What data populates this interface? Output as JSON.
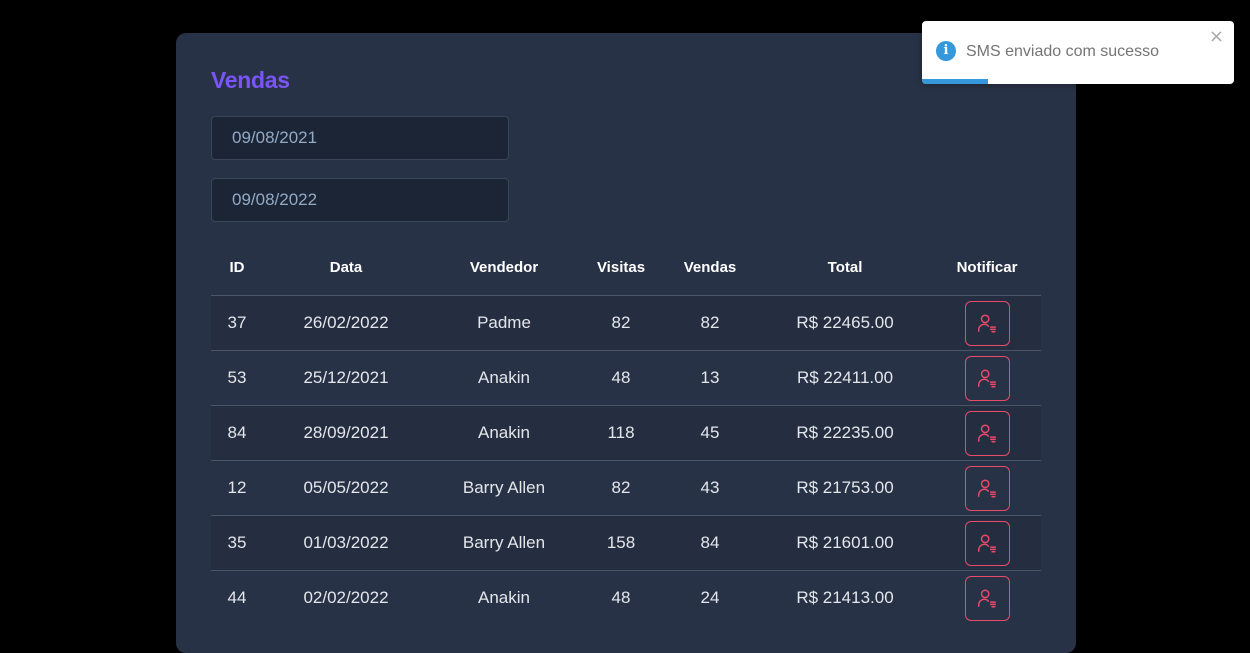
{
  "page": {
    "title": "Vendas",
    "title_color": "#7b54f6"
  },
  "filters": {
    "min_date": "09/08/2021",
    "max_date": "09/08/2022"
  },
  "table": {
    "headers": {
      "id": "ID",
      "date": "Data",
      "seller": "Vendedor",
      "visits": "Visitas",
      "sales": "Vendas",
      "total": "Total",
      "notify": "Notificar"
    },
    "rows": [
      {
        "id": "37",
        "date": "26/02/2022",
        "seller": "Padme",
        "visits": "82",
        "sales": "82",
        "total": "R$ 22465.00"
      },
      {
        "id": "53",
        "date": "25/12/2021",
        "seller": "Anakin",
        "visits": "48",
        "sales": "13",
        "total": "R$ 22411.00"
      },
      {
        "id": "84",
        "date": "28/09/2021",
        "seller": "Anakin",
        "visits": "118",
        "sales": "45",
        "total": "R$ 22235.00"
      },
      {
        "id": "12",
        "date": "05/05/2022",
        "seller": "Barry Allen",
        "visits": "82",
        "sales": "43",
        "total": "R$ 21753.00"
      },
      {
        "id": "35",
        "date": "01/03/2022",
        "seller": "Barry Allen",
        "visits": "158",
        "sales": "84",
        "total": "R$ 21601.00"
      },
      {
        "id": "44",
        "date": "02/02/2022",
        "seller": "Anakin",
        "visits": "48",
        "sales": "24",
        "total": "R$ 21413.00"
      }
    ],
    "notify_icon": "user-notify-icon",
    "notify_color": "#e84a6a"
  },
  "toast": {
    "message": "SMS enviado com sucesso",
    "icon": "info-icon",
    "close_label": "×",
    "color": "#3498db",
    "progress": 0.21
  }
}
